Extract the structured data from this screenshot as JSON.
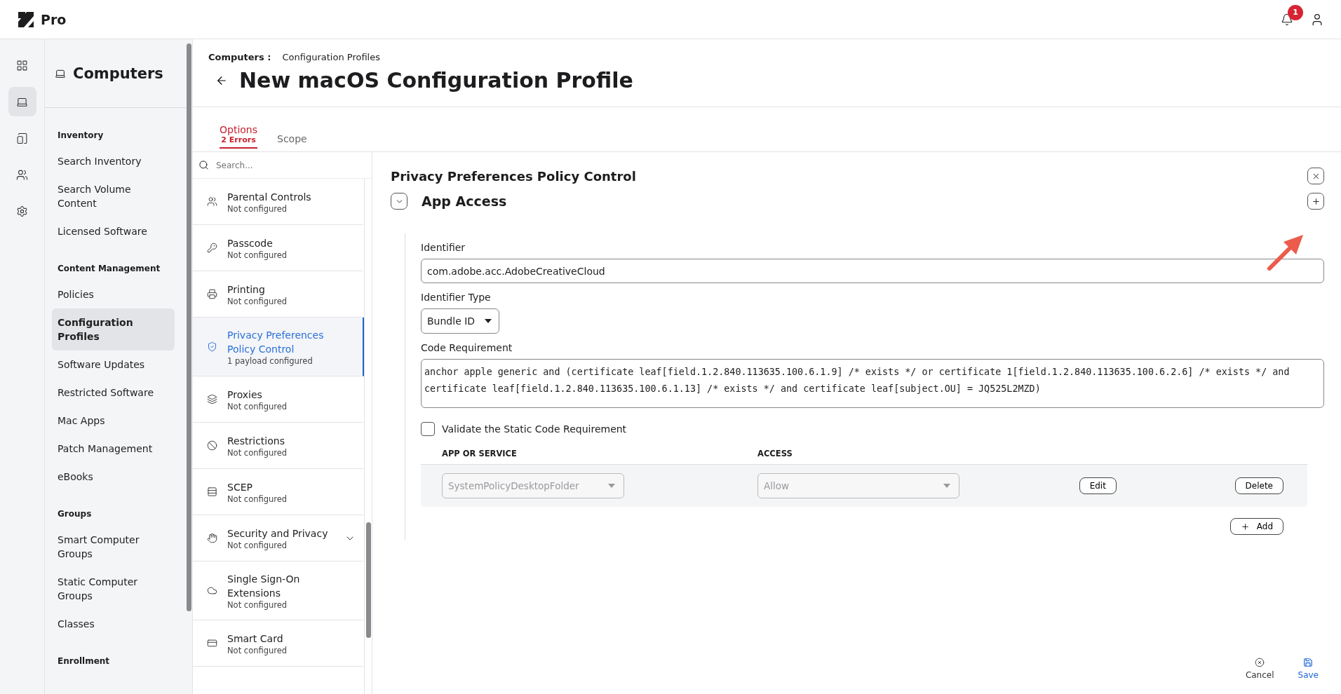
{
  "app": {
    "name": "Pro",
    "notification_count": "1"
  },
  "rail": [
    {
      "selected": false
    },
    {
      "selected": true
    },
    {
      "selected": false
    },
    {
      "selected": false
    },
    {
      "selected": false
    }
  ],
  "nav": {
    "title": "Computers",
    "sections": [
      {
        "heading": "Inventory",
        "items": [
          {
            "label": "Search Inventory",
            "selected": false
          },
          {
            "label": "Search Volume Content",
            "selected": false
          },
          {
            "label": "Licensed Software",
            "selected": false
          }
        ]
      },
      {
        "heading": "Content Management",
        "items": [
          {
            "label": "Policies",
            "selected": false
          },
          {
            "label": "Configuration Profiles",
            "selected": true
          },
          {
            "label": "Software Updates",
            "selected": false
          },
          {
            "label": "Restricted Software",
            "selected": false
          },
          {
            "label": "Mac Apps",
            "selected": false
          },
          {
            "label": "Patch Management",
            "selected": false
          },
          {
            "label": "eBooks",
            "selected": false
          }
        ]
      },
      {
        "heading": "Groups",
        "items": [
          {
            "label": "Smart Computer Groups",
            "selected": false
          },
          {
            "label": "Static Computer Groups",
            "selected": false
          },
          {
            "label": "Classes",
            "selected": false
          }
        ]
      },
      {
        "heading": "Enrollment"
      }
    ]
  },
  "breadcrumb": {
    "parent": "Computers :",
    "current": "Configuration Profiles"
  },
  "page_title": "New macOS Configuration Profile",
  "tabs": [
    {
      "label": "Options",
      "error": "2 Errors",
      "selected": true
    },
    {
      "label": "Scope",
      "selected": false
    }
  ],
  "payload_search": {
    "placeholder": "Search..."
  },
  "payloads": [
    {
      "name": "Parental Controls",
      "status": "Not configured",
      "selected": false,
      "expandable": false
    },
    {
      "name": "Passcode",
      "status": "Not configured",
      "selected": false,
      "expandable": false
    },
    {
      "name": "Printing",
      "status": "Not configured",
      "selected": false,
      "expandable": false
    },
    {
      "name": "Privacy Preferences Policy Control",
      "status": "1 payload configured",
      "selected": true,
      "expandable": false
    },
    {
      "name": "Proxies",
      "status": "Not configured",
      "selected": false,
      "expandable": false
    },
    {
      "name": "Restrictions",
      "status": "Not configured",
      "selected": false,
      "expandable": false
    },
    {
      "name": "SCEP",
      "status": "Not configured",
      "selected": false,
      "expandable": false
    },
    {
      "name": "Security and Privacy",
      "status": "Not configured",
      "selected": false,
      "expandable": true
    },
    {
      "name": "Single Sign-On Extensions",
      "status": "Not configured",
      "selected": false,
      "expandable": false
    },
    {
      "name": "Smart Card",
      "status": "Not configured",
      "selected": false,
      "expandable": false
    }
  ],
  "panel": {
    "title": "Privacy Preferences Policy Control",
    "section": {
      "title": "App Access",
      "expanded": true
    },
    "fields": [
      {
        "kind": "text",
        "label": "Identifier",
        "value": "com.adobe.acc.AdobeCreativeCloud"
      },
      {
        "kind": "select",
        "label": "Identifier Type",
        "value": "Bundle ID"
      },
      {
        "kind": "code",
        "label": "Code Requirement",
        "value": "anchor apple generic and (certificate leaf[field.1.2.840.113635.100.6.1.9] /* exists */ or certificate 1[field.1.2.840.113635.100.6.2.6] /* exists */ and certificate leaf[field.1.2.840.113635.100.6.1.13] /* exists */ and certificate leaf[subject.OU] = JQ525L2MZD)"
      }
    ],
    "validate": {
      "label": "Validate the Static Code Requirement",
      "checked": false
    },
    "table": {
      "columns": [
        "APP OR SERVICE",
        "ACCESS"
      ],
      "rows": [
        {
          "service": "SystemPolicyDesktopFolder",
          "access": "Allow",
          "disabled": true,
          "edit": "Edit",
          "delete": "Delete"
        }
      ]
    },
    "add_button": "Add"
  },
  "footer": {
    "cancel": "Cancel",
    "save": "Save"
  }
}
